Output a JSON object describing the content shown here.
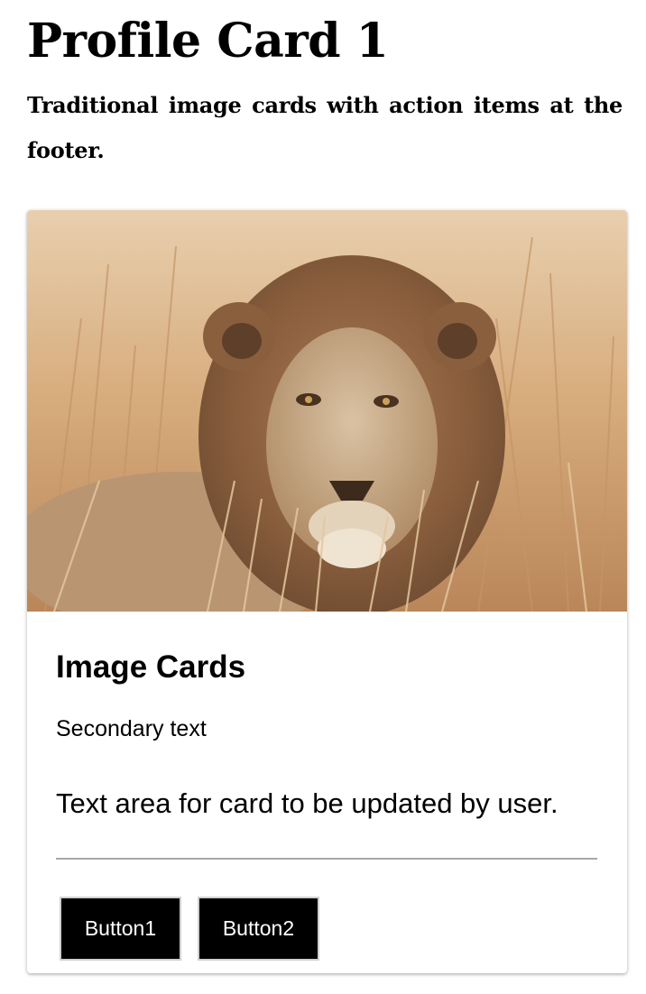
{
  "page": {
    "title": "Profile Card 1",
    "subtitle": "Traditional image cards with action items at the footer."
  },
  "card": {
    "image": {
      "subject": "lion-in-grass-photo"
    },
    "title": "Image Cards",
    "secondary_text": "Secondary text",
    "body_text": "Text area for card to be updated by user.",
    "actions": [
      {
        "label": "Button1"
      },
      {
        "label": "Button2"
      }
    ]
  },
  "colors": {
    "button_background": "#000000",
    "button_text": "#ffffff",
    "divider": "#a8a8a8",
    "image_tones": [
      "#d9b98e",
      "#b8875a",
      "#7a5535"
    ]
  }
}
